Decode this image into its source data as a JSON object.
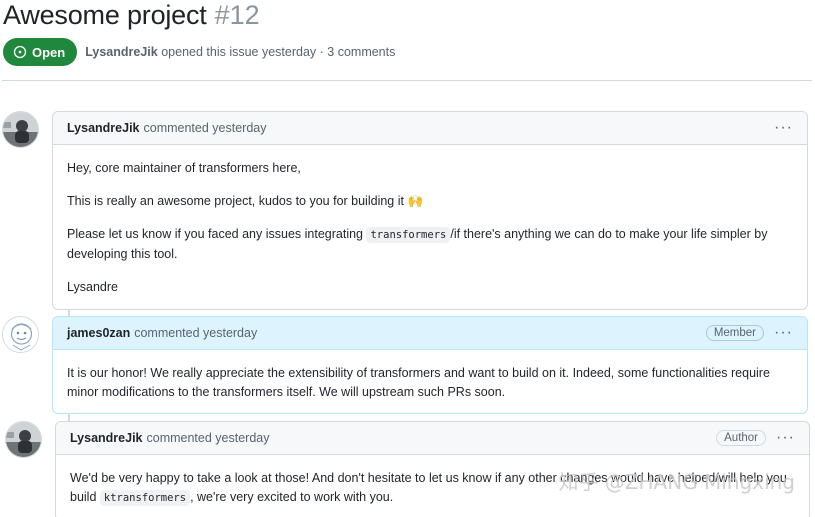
{
  "issue": {
    "title": "Awesome project",
    "number": "#12",
    "state_label": "Open",
    "opener": "LysandreJik",
    "meta_suffix": "opened this issue yesterday · 3 comments"
  },
  "comments": [
    {
      "author": "LysandreJik",
      "action": "commented yesterday",
      "role": "",
      "paragraphs": [
        "Hey, core maintainer of transformers here,",
        "This is really an awesome project, kudos to you for building it 🙌",
        "Please let us know if you faced any issues integrating ",
        "Lysandre"
      ],
      "inline_code": "transformers",
      "after_code": "/if there's anything we can do to make your life simpler by developing this tool."
    },
    {
      "author": "james0zan",
      "action": "commented yesterday",
      "role": "Member",
      "paragraphs": [
        "It is our honor! We really appreciate the extensibility of transformers and want to build on it. Indeed, some functionalities require minor modifications to the transformers itself. We will upstream such PRs soon."
      ]
    },
    {
      "author": "LysandreJik",
      "action": "commented yesterday",
      "role": "Author",
      "paragraphs": [
        "We'd be very happy to take a look at those! And don't hesitate to let us know if any other changes would have helped/will help you build ",
        ", we're very excited to work with you."
      ],
      "inline_code": "ktransformers"
    }
  ],
  "watermark": "知乎 @ZHANG Mingxing",
  "colors": {
    "open_green": "#1f883d",
    "member_header": "#ddf4ff",
    "header_bg": "#f6f8fa",
    "border": "#d1d9e0"
  },
  "icons": [
    "issue-opened-icon",
    "kebab-menu-icon",
    "avatar-lysandrejik",
    "avatar-james0zan"
  ]
}
